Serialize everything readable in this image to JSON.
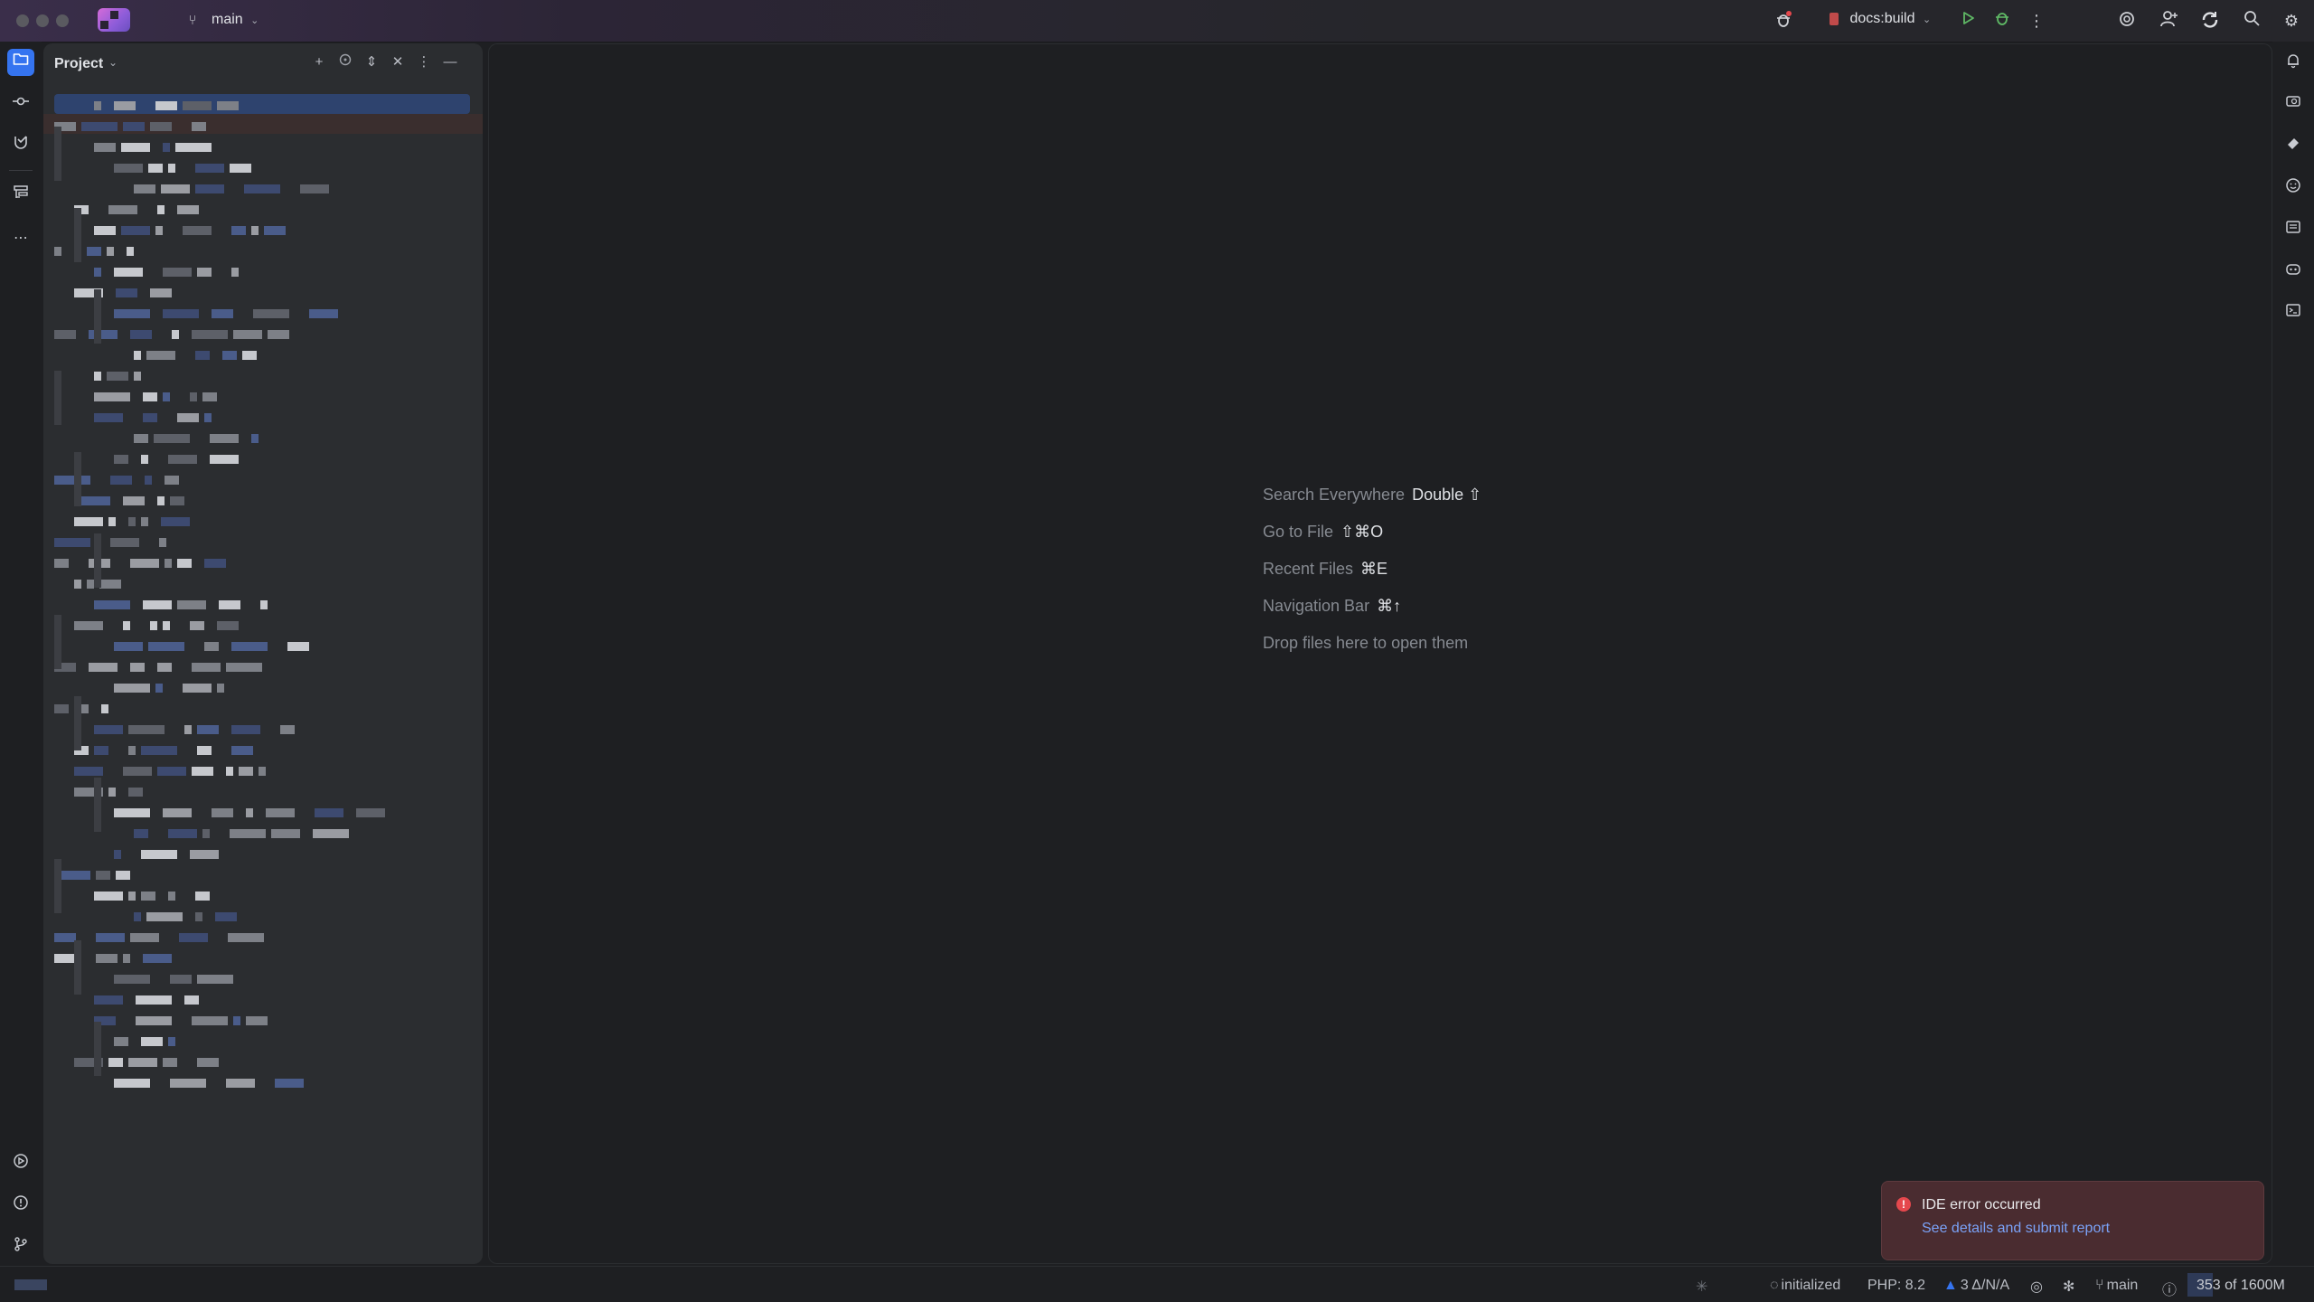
{
  "titlebar": {
    "branch": "main",
    "run_config": "docs:build",
    "icons": [
      "debug-bug-icon",
      "run-icon",
      "debug-icon",
      "more-icon",
      "ai-assistant-icon",
      "add-user-icon",
      "sync-icon",
      "search-icon",
      "settings-icon"
    ]
  },
  "left_toolbar": {
    "icons": [
      "project-folder-icon",
      "commit-icon",
      "pull-requests-icon",
      "structure-icon",
      "more-tools-icon",
      "services-icon",
      "problems-icon",
      "git-icon"
    ]
  },
  "right_toolbar": {
    "icons": [
      "notifications-icon",
      "ai-chat-icon",
      "plugin-icon",
      "emoji-icon",
      "database-icon",
      "copilot-icon",
      "terminal-icon"
    ]
  },
  "project_panel": {
    "title": "Project",
    "tools": [
      "add-icon",
      "locate-icon",
      "expand-icon",
      "collapse-icon",
      "options-icon",
      "hide-icon"
    ]
  },
  "editor": {
    "hints": [
      {
        "label": "Search Everywhere",
        "key": "Double ⇧"
      },
      {
        "label": "Go to File",
        "key": "⇧⌘O"
      },
      {
        "label": "Recent Files",
        "key": "⌘E"
      },
      {
        "label": "Navigation Bar",
        "key": "⌘↑"
      },
      {
        "label": "Drop files here to open them",
        "key": ""
      }
    ]
  },
  "notification": {
    "title": "IDE error occurred",
    "link": "See details and submit report"
  },
  "statusbar": {
    "state": "initialized",
    "php": "PHP: 8.2",
    "inspections": "3 Δ/N/A",
    "branch": "main",
    "memory": "353 of 1600M",
    "memory_used_fraction": 0.22
  }
}
